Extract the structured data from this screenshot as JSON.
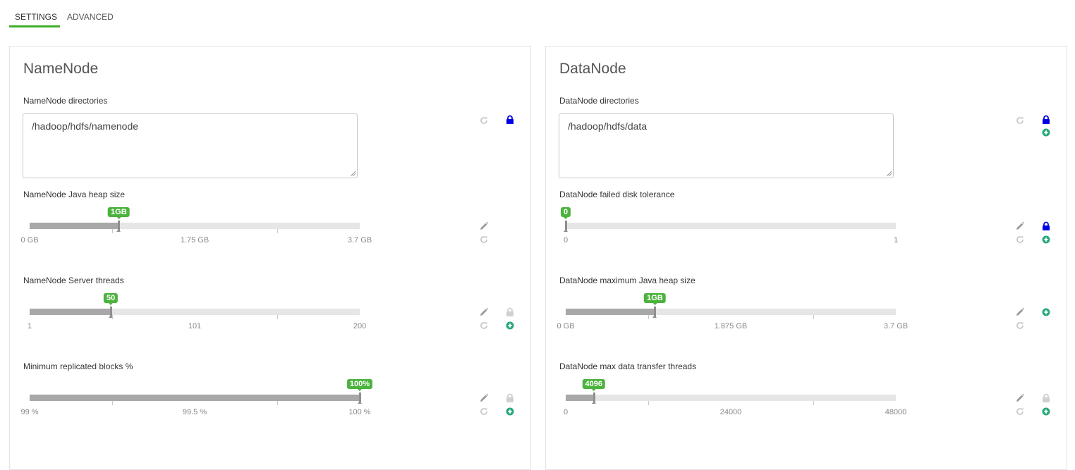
{
  "tabs": [
    {
      "label": "SETTINGS",
      "active": true
    },
    {
      "label": "ADVANCED",
      "active": false
    }
  ],
  "colors": {
    "accent": "#3fae2a",
    "badge": "#4cb33f",
    "lock_active": "#0000e6",
    "add": "#2aa87a"
  },
  "namenode": {
    "title": "NameNode",
    "directories": {
      "label": "NameNode directories",
      "value": "/hadoop/hdfs/namenode"
    },
    "heap": {
      "label": "NameNode Java heap size",
      "badge": "1GB",
      "fraction": 0.27,
      "ticks": [
        "0 GB",
        "1.75 GB",
        "3.7 GB"
      ]
    },
    "threads": {
      "label": "NameNode Server threads",
      "badge": "50",
      "fraction": 0.246,
      "ticks": [
        "1",
        "101",
        "200"
      ]
    },
    "min_blocks": {
      "label": "Minimum replicated blocks %",
      "badge": "100%",
      "fraction": 1.0,
      "ticks": [
        "99 %",
        "99.5 %",
        "100 %"
      ]
    }
  },
  "datanode": {
    "title": "DataNode",
    "directories": {
      "label": "DataNode directories",
      "value": "/hadoop/hdfs/data"
    },
    "disk_tolerance": {
      "label": "DataNode failed disk tolerance",
      "badge": "0",
      "fraction": 0.0,
      "ticks": [
        "0",
        "1"
      ]
    },
    "max_heap": {
      "label": "DataNode maximum Java heap size",
      "badge": "1GB",
      "fraction": 0.27,
      "ticks": [
        "0 GB",
        "1.875 GB",
        "3.7 GB"
      ]
    },
    "transfer_threads": {
      "label": "DataNode max data transfer threads",
      "badge": "4096",
      "fraction": 0.085,
      "ticks": [
        "0",
        "24000",
        "48000"
      ]
    }
  },
  "icons": {
    "refresh": "refresh-icon",
    "edit": "pencil-icon",
    "lock": "lock-icon",
    "add": "plus-circle-icon"
  }
}
